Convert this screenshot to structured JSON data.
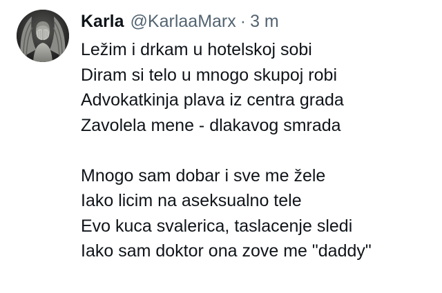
{
  "tweet": {
    "author": {
      "display_name": "Karla",
      "handle": "@KarlaaMarx",
      "separator": "·",
      "timestamp": "3 m",
      "avatar_icon": "weeping-angel-statue-avatar"
    },
    "stanza1": [
      "Ležim i drkam u hotelskoj sobi",
      "Diram si telo u mnogo skupoj robi",
      "Advokatkinja plava iz centra grada",
      "Zavolela mene - dlakavog smrada"
    ],
    "stanza2": [
      "Mnogo sam dobar i sve me žele",
      "Iako licim na aseksualno tele",
      "Evo kuca svalerica, taslacenje sledi",
      "Iako sam doktor ona zove me \"daddy\""
    ]
  }
}
